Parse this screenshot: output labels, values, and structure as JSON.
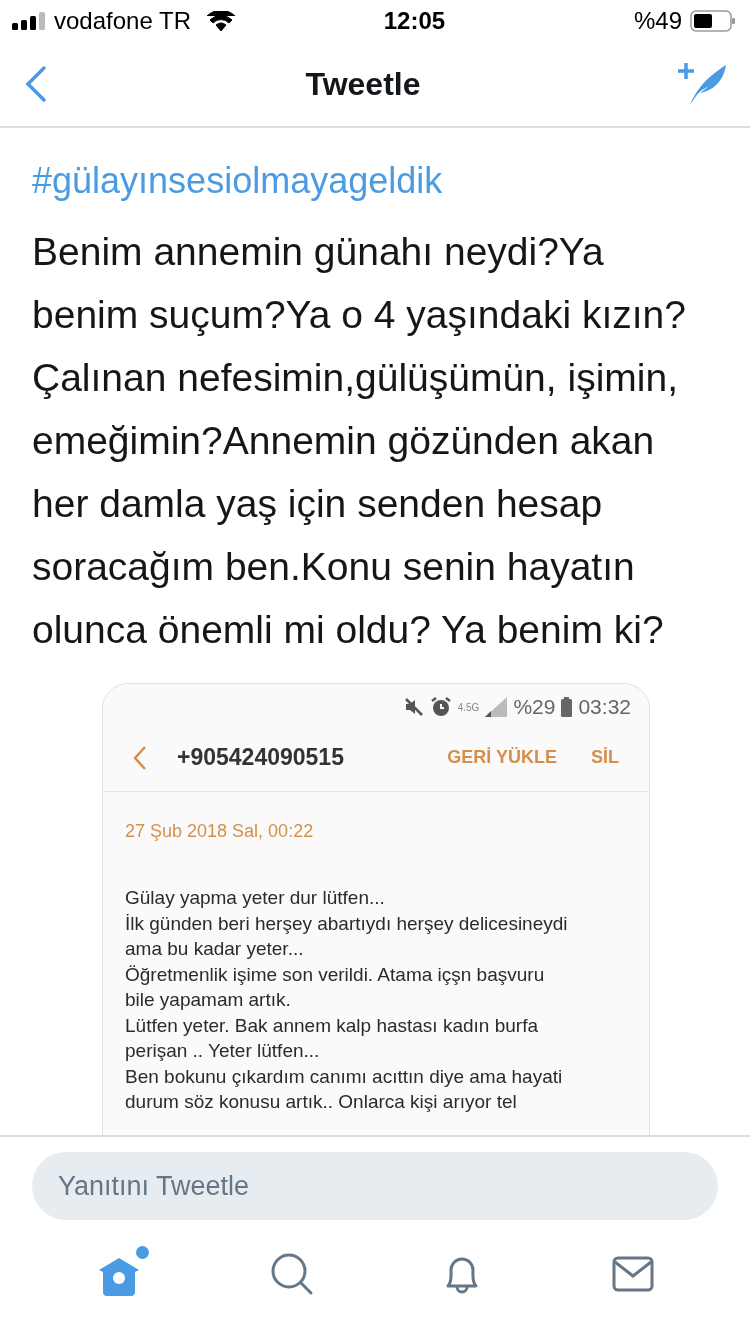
{
  "status_bar": {
    "carrier": "vodafone TR",
    "time": "12:05",
    "battery": "%49"
  },
  "nav": {
    "title": "Tweetle"
  },
  "tweet": {
    "hashtag": "#gülayınsesiolmayageldik",
    "text": "Benim annemin günahı neydi?Ya benim suçum?Ya o 4 yaşındaki kızın? Çalınan nefesimin,gülüşümün, işimin, emeğimin?Annemin gözünden akan her damla yaş için senden hesap soracağım ben.Konu senin hayatın olunca önemli mi oldu? Ya benim ki?"
  },
  "attached_screenshot": {
    "status": {
      "network": "4.5G",
      "battery": "%29",
      "time": "03:32"
    },
    "contact": "+905424090515",
    "actions": [
      "GERİ YÜKLE",
      "SİL"
    ],
    "date": "27 Şub 2018 Sal, 00:22",
    "message_lines": [
      "Gülay yapma yeter dur lütfen...",
      "İlk günden beri herşey abartıydı herşey delicesineydi",
      "ama bu kadar yeter...",
      "Öğretmenlik işime son verildi. Atama içşn başvuru",
      "bile yapamam artık.",
      "Lütfen yeter. Bak annem kalp hastası kadın burfa",
      "perişan .. Yeter lütfen...",
      "Ben bokunu çıkardım canımı acıttın diye ama hayati",
      "durum söz konusu artık.. Onlarca kişi arıyor tel"
    ]
  },
  "reply": {
    "placeholder": "Yanıtını Tweetle"
  },
  "tabs": [
    {
      "kind": "home",
      "selected": true,
      "badge": true
    },
    {
      "kind": "search",
      "selected": false,
      "badge": false
    },
    {
      "kind": "notifications",
      "selected": false,
      "badge": false
    },
    {
      "kind": "messages",
      "selected": false,
      "badge": false
    }
  ]
}
